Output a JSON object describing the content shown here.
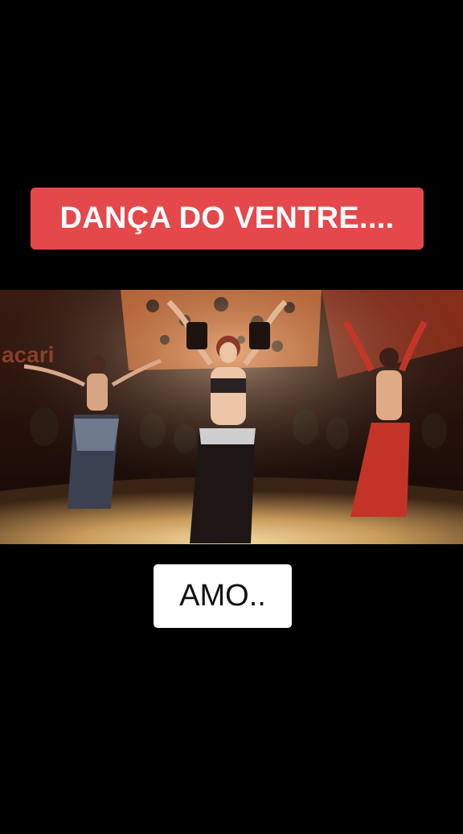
{
  "captions": {
    "title": "DANÇA DO VENTRE....",
    "subtitle": "AMO.."
  },
  "video": {
    "subject": "three belly dancers performing on a stage",
    "backdrop_text": "acari"
  },
  "colors": {
    "background": "#000000",
    "title_caption_bg": "#e5484a",
    "title_caption_text": "#ffffff",
    "subtitle_caption_bg": "#ffffff",
    "subtitle_caption_text": "#111111"
  }
}
